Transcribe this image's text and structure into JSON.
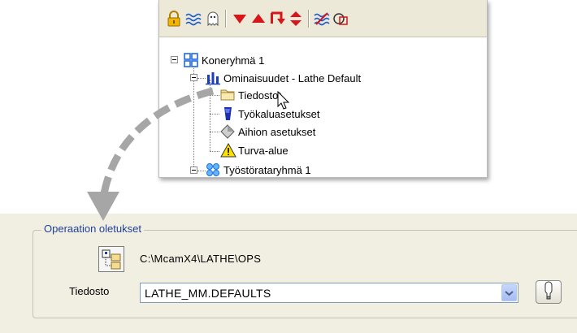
{
  "toolbar": {
    "icons": [
      "lock-icon",
      "wave-icon",
      "ghost-icon",
      "triangle-down-icon",
      "triangle-up-icon",
      "insert-arrow-icon",
      "up-down-arrow-icon",
      "regenerate-icon",
      "backplot-icon"
    ]
  },
  "tree": {
    "machine_group": "Koneryhmä 1",
    "properties": "Ominaisuudet - Lathe Default",
    "files": "Tiedostot",
    "tool_settings": "Työkaluasetukset",
    "stock_setup": "Aihion asetukset",
    "safety_zone": "Turva-alue",
    "toolpath_group": "Työstörataryhmä 1"
  },
  "operations": {
    "group_title": "Operaation oletukset",
    "path": "C:\\McamX4\\LATHE\\OPS",
    "file_label": "Tiedosto",
    "file_value": "LATHE_MM.DEFAULTS"
  },
  "colors": {
    "panel_bg": "#ece9d8",
    "group_bg": "#f1efe2",
    "group_title": "#1f3f9a",
    "toolbar_red": "#d8151a",
    "toolbar_gold": "#e0a800",
    "arrow_gray": "#a6a6a6"
  }
}
